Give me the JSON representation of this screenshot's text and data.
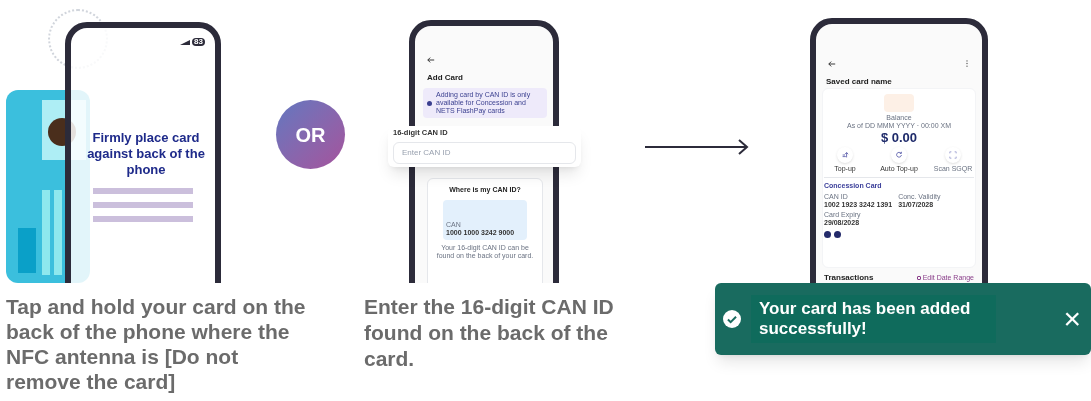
{
  "tap_step": {
    "battery": "83",
    "message": "Firmly place card against back of the phone",
    "caption": "Tap and hold your card on the back of the phone where the NFC antenna is [Do not remove the card]"
  },
  "or_badge": "OR",
  "can_step": {
    "title": "Add Card",
    "notice": "Adding card by CAN ID is only available for Concession and NETS FlashPay cards",
    "field_label": "16-digit CAN ID",
    "placeholder": "Enter CAN ID",
    "help_title": "Where is my CAN ID?",
    "card_label": "CAN",
    "card_number": "1000 1000 3242 9000",
    "help_text": "Your 16-digit CAN ID can be found on the back of your card.",
    "caption": "Enter the 16-digit CAN ID found on the back of the card."
  },
  "result_step": {
    "title": "Saved card name",
    "balance_label": "Balance",
    "balance_date": "As of DD MMM YYYY · 00:00 XM",
    "balance": "$ 0.00",
    "actions": [
      {
        "kind": "topup",
        "label": "Top-up",
        "disabled": false
      },
      {
        "kind": "auto",
        "label": "Auto Top-up",
        "disabled": false
      },
      {
        "kind": "scan",
        "label": "Scan SGQR",
        "disabled": true
      }
    ],
    "card_type": "Concession Card",
    "details": [
      {
        "label": "CAN ID",
        "value": "1002 1923 3242 1391"
      },
      {
        "label": "Conc. Validity",
        "value": "31/07/2028"
      },
      {
        "label": "Card Expiry",
        "value": "29/08/2028"
      }
    ],
    "transactions_title": "Transactions",
    "date_range_link": "Edit Date Range"
  },
  "toast": {
    "message": "Your card has been added successfully!",
    "close": "×"
  }
}
